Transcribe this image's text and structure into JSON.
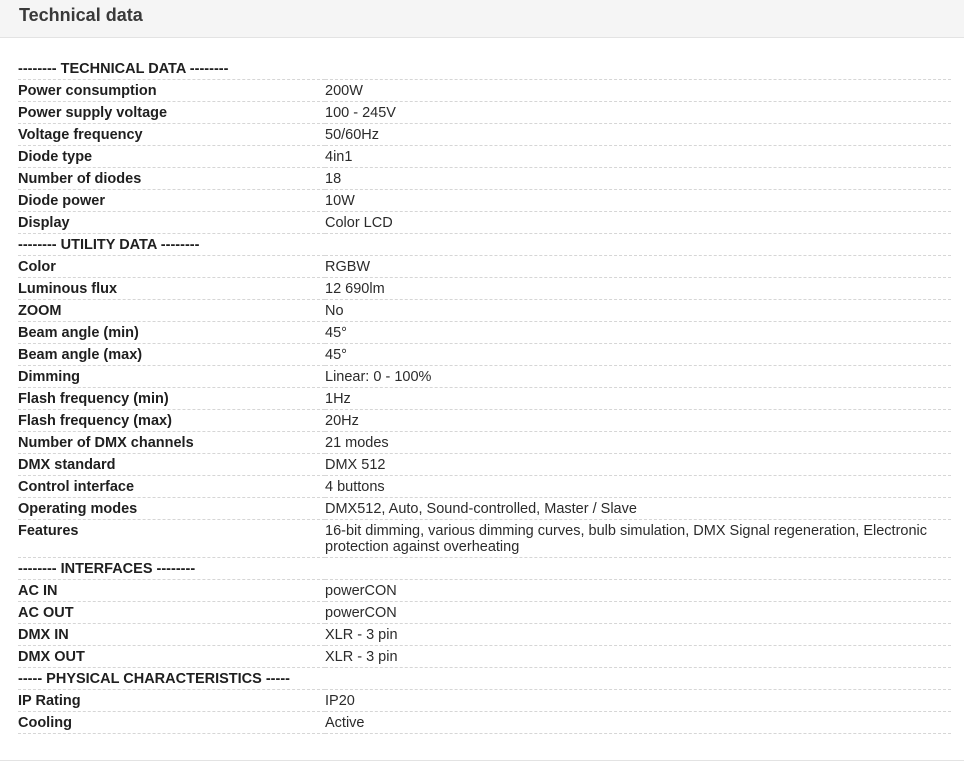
{
  "panel": {
    "title": "Technical data"
  },
  "spec_rows": [
    {
      "type": "section",
      "label": "-------- TECHNICAL DATA --------"
    },
    {
      "type": "pair",
      "key": "Power consumption",
      "value": "200W"
    },
    {
      "type": "pair",
      "key": "Power supply voltage",
      "value": "100 - 245V"
    },
    {
      "type": "pair",
      "key": "Voltage frequency",
      "value": "50/60Hz"
    },
    {
      "type": "pair",
      "key": "Diode type",
      "value": "4in1"
    },
    {
      "type": "pair",
      "key": "Number of diodes",
      "value": "18"
    },
    {
      "type": "pair",
      "key": "Diode power",
      "value": "10W"
    },
    {
      "type": "pair",
      "key": "Display",
      "value": "Color LCD"
    },
    {
      "type": "section",
      "label": "-------- UTILITY DATA --------"
    },
    {
      "type": "pair",
      "key": "Color",
      "value": "RGBW"
    },
    {
      "type": "pair",
      "key": "Luminous flux",
      "value": "12 690lm"
    },
    {
      "type": "pair",
      "key": "ZOOM",
      "value": "No"
    },
    {
      "type": "pair",
      "key": "Beam angle (min)",
      "value": "45°"
    },
    {
      "type": "pair",
      "key": "Beam angle (max)",
      "value": "45°"
    },
    {
      "type": "pair",
      "key": "Dimming",
      "value": "Linear: 0 - 100%"
    },
    {
      "type": "pair",
      "key": "Flash frequency (min)",
      "value": "1Hz"
    },
    {
      "type": "pair",
      "key": "Flash frequency (max)",
      "value": "20Hz"
    },
    {
      "type": "pair",
      "key": "Number of DMX channels",
      "value": "21 modes"
    },
    {
      "type": "pair",
      "key": "DMX standard",
      "value": "DMX 512"
    },
    {
      "type": "pair",
      "key": "Control interface",
      "value": "4 buttons"
    },
    {
      "type": "pair",
      "key": "Operating modes",
      "value": "DMX512, Auto, Sound-controlled, Master / Slave"
    },
    {
      "type": "pair",
      "key": "Features",
      "value": "16-bit dimming, various dimming curves, bulb simulation, DMX Signal regeneration, Electronic protection against overheating"
    },
    {
      "type": "section",
      "label": "-------- INTERFACES --------"
    },
    {
      "type": "pair",
      "key": "AC IN",
      "value": "powerCON"
    },
    {
      "type": "pair",
      "key": "AC OUT",
      "value": "powerCON"
    },
    {
      "type": "pair",
      "key": "DMX IN",
      "value": "XLR - 3 pin"
    },
    {
      "type": "pair",
      "key": "DMX OUT",
      "value": "XLR - 3 pin"
    },
    {
      "type": "section",
      "label": "----- PHYSICAL CHARACTERISTICS -----"
    },
    {
      "type": "pair",
      "key": "IP Rating",
      "value": "IP20"
    },
    {
      "type": "pair",
      "key": "Cooling",
      "value": "Active"
    }
  ]
}
